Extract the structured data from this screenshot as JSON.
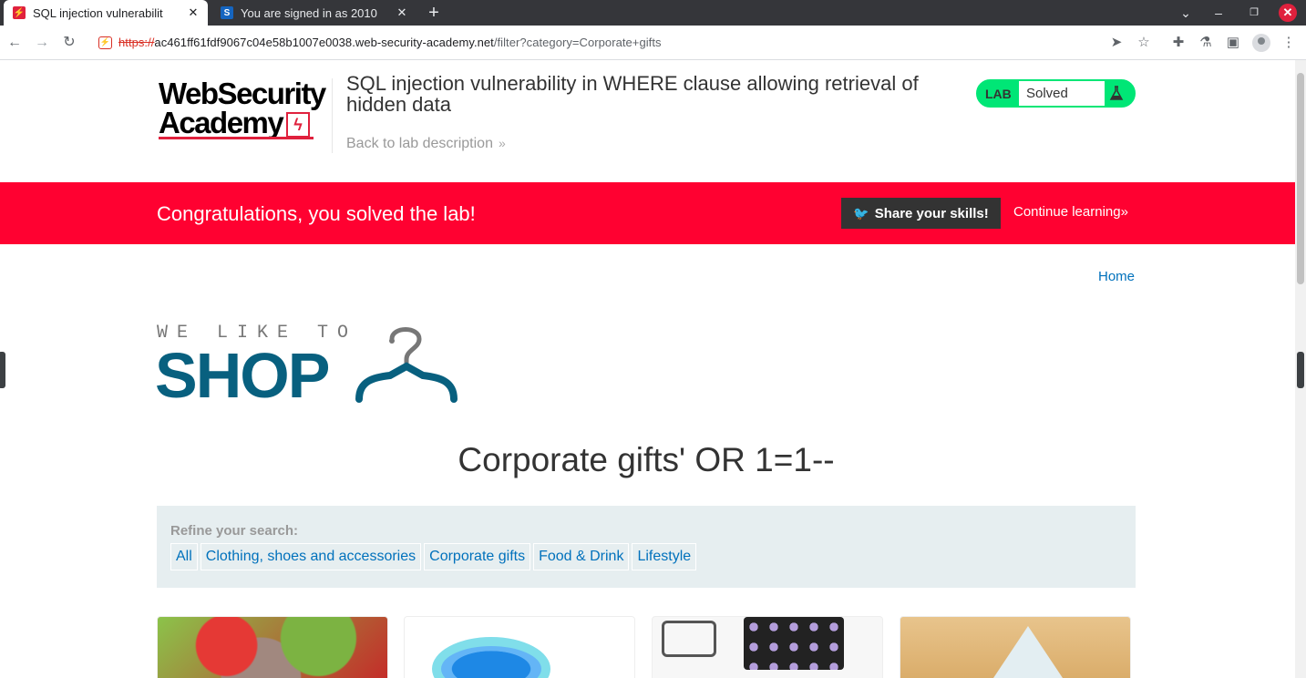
{
  "browser": {
    "tabs": [
      {
        "title": "SQL injection vulnerabilit",
        "close": "✕",
        "active": true,
        "favicon_color": "#e0213d"
      },
      {
        "title": "You are signed in as 2010",
        "close": "✕",
        "active": false,
        "favicon_color": "#1565c0",
        "favicon_letter": "S"
      }
    ],
    "new_tab": "+",
    "url": {
      "scheme": "https://",
      "host": "ac461ff61fdf9067c04e58b1007e0038.web-security-academy.net",
      "path": "/filter?category=Corporate+gifts"
    }
  },
  "academy": {
    "logo_line1": "WebSecurity",
    "logo_line2": "Academy",
    "lab_title": "SQL injection vulnerability in WHERE clause allowing retrieval of hidden data",
    "back_link": "Back to lab description",
    "lab_badge": "LAB",
    "lab_status": "Solved"
  },
  "banner": {
    "text": "Congratulations, you solved the lab!",
    "share_label": "Share your skills!",
    "continue_label": "Continue learning"
  },
  "shop": {
    "home_link": "Home",
    "logo_top": "WE LIKE TO",
    "logo_main": "SHOP",
    "category_title": "Corporate gifts' OR 1=1--",
    "refine_label": "Refine your search:",
    "filters": [
      "All",
      "Clothing, shoes and accessories",
      "Corporate gifts",
      "Food & Drink",
      "Lifestyle"
    ]
  },
  "colors": {
    "accent_red": "#ff0131",
    "solved_green": "#00e676",
    "link_blue": "#0071bc",
    "shop_blue": "#08607f"
  }
}
